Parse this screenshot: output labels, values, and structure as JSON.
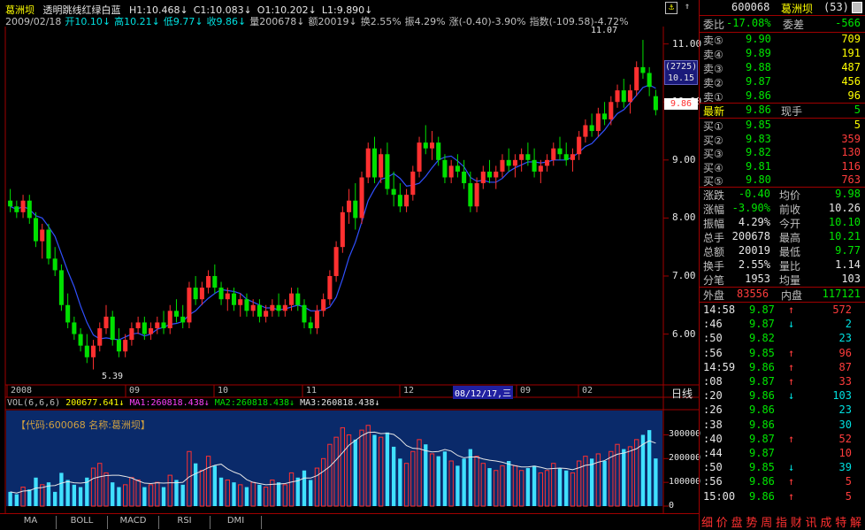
{
  "header": {
    "stock_name": "葛洲坝",
    "style_name": "透明跳线红绿白蓝",
    "ma_info": [
      {
        "text": "H1:10.468↓",
        "color": "#e6e6e6"
      },
      {
        "text": "C1:10.083↓",
        "color": "#e6e6e6"
      },
      {
        "text": "O1:10.202↓",
        "color": "#e6e6e6"
      },
      {
        "text": "L1:9.890↓",
        "color": "#e6e6e6"
      }
    ],
    "line2": [
      {
        "text": "2009/02/18",
        "color": "#c0c0c0"
      },
      {
        "text": "开10.10↓",
        "color": "#00e0e0"
      },
      {
        "text": "高10.21↓",
        "color": "#00e0e0"
      },
      {
        "text": "低9.77↓",
        "color": "#00e0e0"
      },
      {
        "text": "收9.86↓",
        "color": "#00e0e0"
      },
      {
        "text": "量200678↓",
        "color": "#c0c0c0"
      },
      {
        "text": "额20019↓",
        "color": "#c0c0c0"
      },
      {
        "text": "换2.55%",
        "color": "#c0c0c0"
      },
      {
        "text": "振4.29%",
        "color": "#c0c0c0"
      },
      {
        "text": "涨(-0.40)-3.90%",
        "color": "#c0c0c0"
      },
      {
        "text": "指数(-109.58)-4.72%",
        "color": "#c0c0c0"
      }
    ],
    "lock_icon": "lock-icon"
  },
  "price_axis": {
    "ticks": [
      "11.00",
      "10.00",
      "9.00",
      "8.00",
      "7.00",
      "6.00"
    ],
    "high_marker": "11.07",
    "low_marker": "5.39",
    "cursor_label_top": "(2725)",
    "cursor_label_value": "10.15",
    "current_price": "9.86"
  },
  "date_axis": {
    "labels": [
      "2008",
      "09",
      "10",
      "11",
      "12",
      "08/12/17,三",
      "09",
      "02"
    ],
    "right_label": "日线"
  },
  "vol_header": [
    {
      "text": "VOL(6,6,6)",
      "color": "#c0c0c0"
    },
    {
      "text": "200677.641↓",
      "color": "#ffff00"
    },
    {
      "text": "MA1:260818.438↓",
      "color": "#ff40ff"
    },
    {
      "text": "MA2:260818.438↓",
      "color": "#00e600"
    },
    {
      "text": "MA3:260818.438↓",
      "color": "#e6e6e6"
    }
  ],
  "vol_panel": {
    "code_label": "【代码:600068 名称:葛洲坝】",
    "ticks": [
      "300000",
      "200000",
      "100000",
      "0"
    ]
  },
  "tabs": [
    "MA",
    "BOLL",
    "MACD",
    "RSI",
    "DMI"
  ],
  "quote": {
    "code": "600068",
    "name": "葛洲坝",
    "num": "(53)",
    "weibi_label": "委比",
    "weibi_value": "-17.08%",
    "weicha_label": "委差",
    "weicha_value": "-566",
    "asks": [
      {
        "label": "卖⑤",
        "price": "9.90",
        "vol": "709"
      },
      {
        "label": "卖④",
        "price": "9.89",
        "vol": "191"
      },
      {
        "label": "卖③",
        "price": "9.88",
        "vol": "487"
      },
      {
        "label": "卖②",
        "price": "9.87",
        "vol": "456"
      },
      {
        "label": "卖①",
        "price": "9.86",
        "vol": "96"
      }
    ],
    "last_label": "最新",
    "last_value": "9.86",
    "cur_hand_label": "现手",
    "cur_hand_value": "5",
    "bids": [
      {
        "label": "买①",
        "price": "9.85",
        "vol": "5"
      },
      {
        "label": "买②",
        "price": "9.83",
        "vol": "359"
      },
      {
        "label": "买③",
        "price": "9.82",
        "vol": "130"
      },
      {
        "label": "买④",
        "price": "9.81",
        "vol": "116"
      },
      {
        "label": "买⑤",
        "price": "9.80",
        "vol": "763"
      }
    ],
    "stats": [
      {
        "l1": "涨跌",
        "v1": "-0.40",
        "c1": "#00e600",
        "l2": "均价",
        "v2": "9.98",
        "c2": "#00e600"
      },
      {
        "l1": "涨幅",
        "v1": "-3.90%",
        "c1": "#00e600",
        "l2": "前收",
        "v2": "10.26",
        "c2": "#e6e6e6"
      },
      {
        "l1": "振幅",
        "v1": "4.29%",
        "c1": "#e6e6e6",
        "l2": "今开",
        "v2": "10.10",
        "c2": "#00e600"
      },
      {
        "l1": "总手",
        "v1": "200678",
        "c1": "#e6e6e6",
        "l2": "最高",
        "v2": "10.21",
        "c2": "#00e600"
      },
      {
        "l1": "总额",
        "v1": "20019",
        "c1": "#e6e6e6",
        "l2": "最低",
        "v2": "9.77",
        "c2": "#00e600"
      },
      {
        "l1": "换手",
        "v1": "2.55%",
        "c1": "#e6e6e6",
        "l2": "量比",
        "v2": "1.14",
        "c2": "#e6e6e6"
      },
      {
        "l1": "分笔",
        "v1": "1953",
        "c1": "#e6e6e6",
        "l2": "均量",
        "v2": "103",
        "c2": "#e6e6e6"
      }
    ],
    "outer_label": "外盘",
    "outer_value": "83556",
    "inner_label": "内盘",
    "inner_value": "117121",
    "ticks": [
      {
        "t": "14:58",
        "p": "9.87",
        "d": "↑",
        "v": "572",
        "pc": "#00e600",
        "vc": "#ff3c3c"
      },
      {
        "t": ":46",
        "p": "9.87",
        "d": "↓",
        "v": "2",
        "pc": "#00e600",
        "vc": "#00e0e0"
      },
      {
        "t": ":50",
        "p": "9.82",
        "d": "",
        "v": "23",
        "pc": "#00e600",
        "vc": "#00e0e0"
      },
      {
        "t": ":56",
        "p": "9.85",
        "d": "↑",
        "v": "96",
        "pc": "#00e600",
        "vc": "#ff3c3c"
      },
      {
        "t": "14:59",
        "p": "9.86",
        "d": "↑",
        "v": "87",
        "pc": "#00e600",
        "vc": "#ff3c3c"
      },
      {
        "t": ":08",
        "p": "9.87",
        "d": "↑",
        "v": "33",
        "pc": "#00e600",
        "vc": "#ff3c3c"
      },
      {
        "t": ":20",
        "p": "9.86",
        "d": "↓",
        "v": "103",
        "pc": "#00e600",
        "vc": "#00e0e0"
      },
      {
        "t": ":26",
        "p": "9.86",
        "d": "",
        "v": "23",
        "pc": "#00e600",
        "vc": "#00e0e0"
      },
      {
        "t": ":38",
        "p": "9.86",
        "d": "",
        "v": "30",
        "pc": "#00e600",
        "vc": "#00e0e0"
      },
      {
        "t": ":40",
        "p": "9.87",
        "d": "↑",
        "v": "52",
        "pc": "#00e600",
        "vc": "#ff3c3c"
      },
      {
        "t": ":44",
        "p": "9.87",
        "d": "",
        "v": "10",
        "pc": "#00e600",
        "vc": "#ff3c3c"
      },
      {
        "t": ":50",
        "p": "9.85",
        "d": "↓",
        "v": "39",
        "pc": "#00e600",
        "vc": "#00e0e0"
      },
      {
        "t": ":56",
        "p": "9.86",
        "d": "↑",
        "v": "5",
        "pc": "#00e600",
        "vc": "#ff3c3c"
      },
      {
        "t": "15:00",
        "p": "9.86",
        "d": "↑",
        "v": "5",
        "pc": "#00e600",
        "vc": "#ff3c3c"
      }
    ]
  },
  "bottom_tabs": [
    "细",
    "价",
    "盘",
    "势",
    "周",
    "指",
    "财",
    "讯",
    "成",
    "特",
    "解"
  ],
  "chart_data": {
    "type": "candlestick",
    "ylim": [
      5.2,
      11.3
    ],
    "candles": [
      [
        8.3,
        8.5,
        8.1,
        8.2
      ],
      [
        8.2,
        8.3,
        8.0,
        8.1
      ],
      [
        8.1,
        8.4,
        8.0,
        8.3
      ],
      [
        8.3,
        8.4,
        7.9,
        8.0
      ],
      [
        8.0,
        8.1,
        7.5,
        7.6
      ],
      [
        7.6,
        7.9,
        7.3,
        7.8
      ],
      [
        7.8,
        7.9,
        7.2,
        7.3
      ],
      [
        7.3,
        7.5,
        7.0,
        7.1
      ],
      [
        7.1,
        7.2,
        6.4,
        6.5
      ],
      [
        6.5,
        6.7,
        6.1,
        6.2
      ],
      [
        6.2,
        6.3,
        5.9,
        6.0
      ],
      [
        6.0,
        6.1,
        5.7,
        5.8
      ],
      [
        5.8,
        6.0,
        5.5,
        5.6
      ],
      [
        5.6,
        5.9,
        5.39,
        5.8
      ],
      [
        5.8,
        6.2,
        5.7,
        6.1
      ],
      [
        6.1,
        6.5,
        6.0,
        6.3
      ],
      [
        6.3,
        6.4,
        5.8,
        5.9
      ],
      [
        5.9,
        6.1,
        5.6,
        5.7
      ],
      [
        5.7,
        6.0,
        5.6,
        5.9
      ],
      [
        5.9,
        6.2,
        5.8,
        6.1
      ],
      [
        6.1,
        6.3,
        6.0,
        6.2
      ],
      [
        6.2,
        6.3,
        5.9,
        6.0
      ],
      [
        6.0,
        6.2,
        5.9,
        6.1
      ],
      [
        6.1,
        6.3,
        6.0,
        6.2
      ],
      [
        6.2,
        6.4,
        6.0,
        6.1
      ],
      [
        6.1,
        6.5,
        6.0,
        6.4
      ],
      [
        6.4,
        6.6,
        6.2,
        6.3
      ],
      [
        6.3,
        6.5,
        6.1,
        6.2
      ],
      [
        6.2,
        6.9,
        6.1,
        6.8
      ],
      [
        6.8,
        7.0,
        6.5,
        6.6
      ],
      [
        6.6,
        6.9,
        6.5,
        6.8
      ],
      [
        6.8,
        7.1,
        6.7,
        7.0
      ],
      [
        7.0,
        7.2,
        6.7,
        6.8
      ],
      [
        6.8,
        6.9,
        6.5,
        6.6
      ],
      [
        6.6,
        6.8,
        6.4,
        6.7
      ],
      [
        6.7,
        6.8,
        6.4,
        6.5
      ],
      [
        6.5,
        6.7,
        6.3,
        6.6
      ],
      [
        6.6,
        6.7,
        6.3,
        6.4
      ],
      [
        6.4,
        6.6,
        6.3,
        6.5
      ],
      [
        6.5,
        6.6,
        6.2,
        6.3
      ],
      [
        6.3,
        6.5,
        6.2,
        6.4
      ],
      [
        6.4,
        6.6,
        6.3,
        6.5
      ],
      [
        6.5,
        6.7,
        6.3,
        6.4
      ],
      [
        6.4,
        6.6,
        6.3,
        6.5
      ],
      [
        6.5,
        6.8,
        6.4,
        6.7
      ],
      [
        6.7,
        6.8,
        6.4,
        6.5
      ],
      [
        6.5,
        6.6,
        6.1,
        6.2
      ],
      [
        6.2,
        6.3,
        6.0,
        6.1
      ],
      [
        6.1,
        6.5,
        6.0,
        6.4
      ],
      [
        6.4,
        6.7,
        6.3,
        6.6
      ],
      [
        6.6,
        7.1,
        6.5,
        7.0
      ],
      [
        7.0,
        7.6,
        6.9,
        7.5
      ],
      [
        7.5,
        8.2,
        7.4,
        8.1
      ],
      [
        8.1,
        8.5,
        7.9,
        8.3
      ],
      [
        8.3,
        8.6,
        7.8,
        8.0
      ],
      [
        8.0,
        8.8,
        7.9,
        8.7
      ],
      [
        8.7,
        9.3,
        8.6,
        9.2
      ],
      [
        9.2,
        9.4,
        8.6,
        8.7
      ],
      [
        8.7,
        9.2,
        8.6,
        9.1
      ],
      [
        9.1,
        9.3,
        8.4,
        8.5
      ],
      [
        8.5,
        8.8,
        8.2,
        8.4
      ],
      [
        8.4,
        8.6,
        8.1,
        8.2
      ],
      [
        8.2,
        8.5,
        8.1,
        8.4
      ],
      [
        8.4,
        8.9,
        8.3,
        8.8
      ],
      [
        8.8,
        9.4,
        8.7,
        9.3
      ],
      [
        9.3,
        9.6,
        9.1,
        9.2
      ],
      [
        9.2,
        9.5,
        9.0,
        9.3
      ],
      [
        9.3,
        9.4,
        8.9,
        9.0
      ],
      [
        9.0,
        9.1,
        8.6,
        8.7
      ],
      [
        8.7,
        9.0,
        8.6,
        8.9
      ],
      [
        8.9,
        9.1,
        8.7,
        8.8
      ],
      [
        8.8,
        9.0,
        8.5,
        8.6
      ],
      [
        8.6,
        8.8,
        8.1,
        8.2
      ],
      [
        8.2,
        8.7,
        8.1,
        8.6
      ],
      [
        8.6,
        8.9,
        8.5,
        8.8
      ],
      [
        8.8,
        9.0,
        8.6,
        8.7
      ],
      [
        8.7,
        8.9,
        8.5,
        8.8
      ],
      [
        8.8,
        9.1,
        8.7,
        9.0
      ],
      [
        9.0,
        9.2,
        8.8,
        8.9
      ],
      [
        8.9,
        9.1,
        8.7,
        9.0
      ],
      [
        9.0,
        9.2,
        8.8,
        9.1
      ],
      [
        9.1,
        9.3,
        8.9,
        9.0
      ],
      [
        9.0,
        9.2,
        8.7,
        8.8
      ],
      [
        8.8,
        9.0,
        8.6,
        8.9
      ],
      [
        8.9,
        9.1,
        8.8,
        9.0
      ],
      [
        9.0,
        9.3,
        8.9,
        9.2
      ],
      [
        9.2,
        9.4,
        9.0,
        9.1
      ],
      [
        9.1,
        9.3,
        8.9,
        9.0
      ],
      [
        9.0,
        9.2,
        8.8,
        9.1
      ],
      [
        9.1,
        9.5,
        9.0,
        9.4
      ],
      [
        9.4,
        9.7,
        9.3,
        9.6
      ],
      [
        9.6,
        9.8,
        9.4,
        9.5
      ],
      [
        9.5,
        9.9,
        9.4,
        9.8
      ],
      [
        9.8,
        10.0,
        9.6,
        9.7
      ],
      [
        9.7,
        10.1,
        9.6,
        10.0
      ],
      [
        10.0,
        10.3,
        9.9,
        10.2
      ],
      [
        10.2,
        10.4,
        9.9,
        10.0
      ],
      [
        10.0,
        10.3,
        9.8,
        10.2
      ],
      [
        10.2,
        10.7,
        10.1,
        10.6
      ],
      [
        10.6,
        11.07,
        10.4,
        10.5
      ],
      [
        10.5,
        10.6,
        10.1,
        10.26
      ],
      [
        10.1,
        10.21,
        9.77,
        9.86
      ]
    ],
    "volume": [
      60000,
      50000,
      80000,
      70000,
      120000,
      90000,
      100000,
      60000,
      140000,
      110000,
      90000,
      80000,
      120000,
      160000,
      180000,
      140000,
      100000,
      80000,
      90000,
      120000,
      110000,
      80000,
      90000,
      100000,
      80000,
      130000,
      110000,
      90000,
      230000,
      180000,
      150000,
      210000,
      170000,
      120000,
      110000,
      100000,
      90000,
      80000,
      100000,
      90000,
      80000,
      110000,
      100000,
      90000,
      140000,
      120000,
      150000,
      110000,
      160000,
      200000,
      260000,
      290000,
      330000,
      300000,
      280000,
      320000,
      340000,
      300000,
      290000,
      310000,
      250000,
      200000,
      180000,
      230000,
      280000,
      260000,
      220000,
      210000,
      230000,
      190000,
      170000,
      200000,
      240000,
      210000,
      180000,
      160000,
      150000,
      170000,
      190000,
      170000,
      150000,
      160000,
      170000,
      140000,
      150000,
      180000,
      160000,
      150000,
      140000,
      190000,
      210000,
      200000,
      220000,
      190000,
      230000,
      260000,
      240000,
      250000,
      280000,
      300000,
      320000,
      200678
    ]
  }
}
